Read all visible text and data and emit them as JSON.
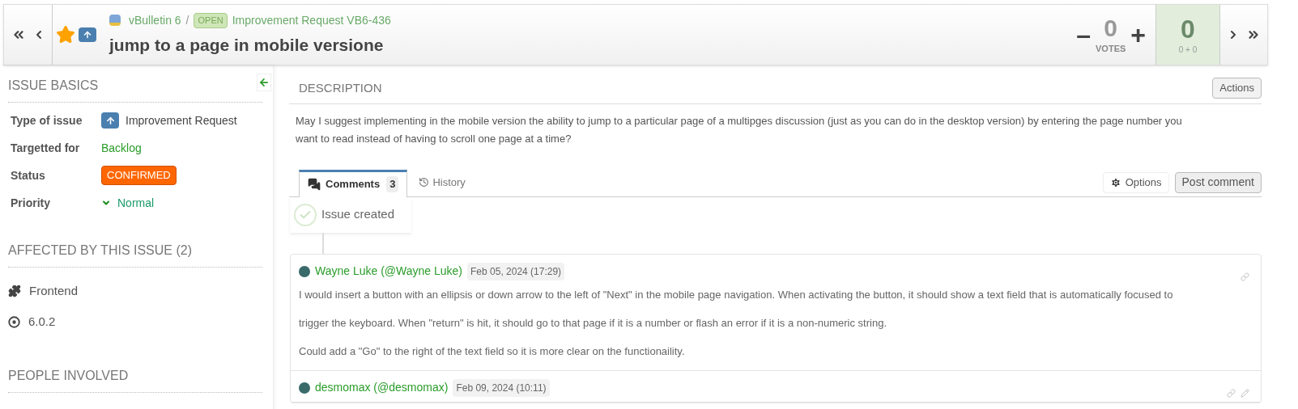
{
  "header": {
    "starred": true,
    "project": "vBulletin 6",
    "separator": "/",
    "status_badge": "OPEN",
    "issue_ref": "Improvement Request VB6-436",
    "title": "jump to a page in mobile versione",
    "votes": {
      "minus": "–",
      "value": "0",
      "label": "VOTES",
      "plus": "+"
    },
    "score": {
      "value": "0",
      "detail": "0 + 0"
    }
  },
  "sidebar": {
    "basics_title": "ISSUE BASICS",
    "fields": [
      {
        "label": "Type of issue",
        "value": "Improvement Request",
        "kind": "type"
      },
      {
        "label": "Targetted for",
        "value": "Backlog",
        "kind": "link"
      },
      {
        "label": "Status",
        "value": "CONFIRMED",
        "kind": "badge"
      },
      {
        "label": "Priority",
        "value": "Normal",
        "kind": "priority"
      }
    ],
    "affected_title": "AFFECTED BY THIS ISSUE (2)",
    "affected": [
      {
        "label": "Frontend",
        "kind": "component"
      },
      {
        "label": "6.0.2",
        "kind": "version"
      }
    ],
    "people_title": "PEOPLE INVOLVED"
  },
  "description": {
    "title": "DESCRIPTION",
    "action": "Actions",
    "text": "May I suggest implementing in the mobile version the ability to jump to a particular page of a multipges discussion (just as you can do in the desktop version) by entering the page number you want to read instead of having to scroll one page at a time?"
  },
  "tabs": [
    {
      "label": "Comments",
      "count": "3",
      "selected": true,
      "kind": "comments"
    },
    {
      "label": "History",
      "selected": false,
      "kind": "history"
    }
  ],
  "tab_buttons": {
    "options": "Options",
    "post": "Post comment"
  },
  "timeline_event": "Issue created",
  "comments": [
    {
      "author": "Wayne Luke (@Wayne Luke)",
      "date": "Feb 05, 2024 (17:29)",
      "paragraphs": [
        "I would insert a button with an ellipsis or down arrow to the left of \"Next\" in the mobile page navigation. When activating the button, it should show a text field that is automatically focused to trigger the keyboard. When \"return\" is hit, it should go to that page if it is a number or flash an error if it is a non-numeric string.",
        "Could add a \"Go\" to the right of the text field so it is more clear on the functionaility."
      ],
      "editable": false
    },
    {
      "author": "desmomax (@desmomax)",
      "date": "Feb 09, 2024 (10:11)",
      "editable": true
    }
  ]
}
